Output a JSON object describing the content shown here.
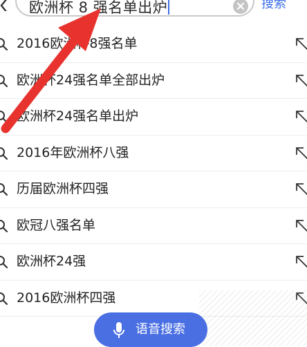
{
  "search": {
    "query": "欧洲杯 8 强名单出炉",
    "submit_label": "搜索"
  },
  "suggestions": [
    {
      "text": "2016欧洲杯8强名单"
    },
    {
      "text": "欧洲杯24强名单全部出炉"
    },
    {
      "text": "欧洲杯24强名单出炉"
    },
    {
      "text": "2016年欧洲杯八强"
    },
    {
      "text": "历届欧洲杯四强"
    },
    {
      "text": "欧冠八强名单"
    },
    {
      "text": "欧洲杯24强"
    },
    {
      "text": "2016欧洲杯四强"
    }
  ],
  "voice_search": {
    "label": "语音搜索"
  },
  "icons": {
    "back": "chevron-left-icon",
    "clear": "clear-circle-icon",
    "suggestion": "search-icon",
    "fill": "arrow-up-left-icon",
    "mic": "microphone-icon"
  },
  "colors": {
    "accent": "#3a6ee8",
    "voice_button": "#4a6fe3",
    "annotation_arrow": "#e8322e"
  }
}
